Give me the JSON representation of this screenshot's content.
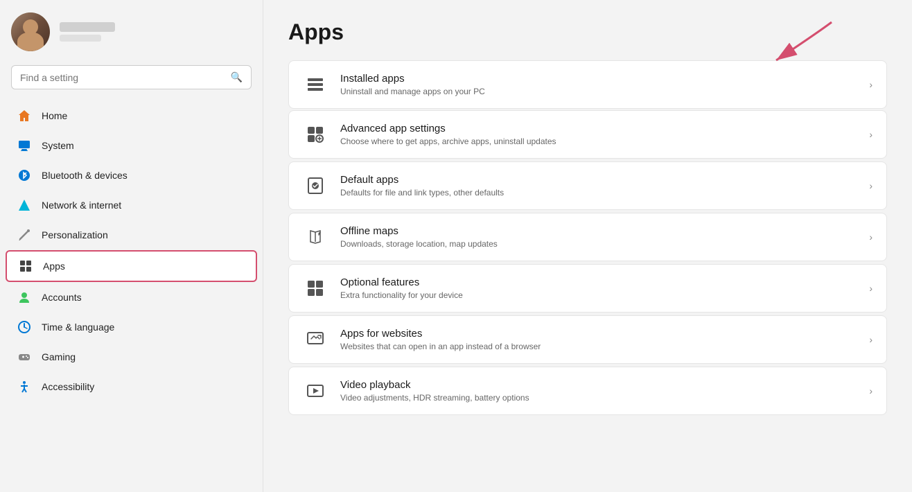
{
  "profile": {
    "name_line1": "",
    "name_line2": ""
  },
  "search": {
    "placeholder": "Find a setting"
  },
  "page_title": "Apps",
  "nav_items": [
    {
      "id": "home",
      "label": "Home",
      "icon": "🏠"
    },
    {
      "id": "system",
      "label": "System",
      "icon": "💻"
    },
    {
      "id": "bluetooth",
      "label": "Bluetooth & devices",
      "icon": "🔵"
    },
    {
      "id": "network",
      "label": "Network & internet",
      "icon": "💠"
    },
    {
      "id": "personalization",
      "label": "Personalization",
      "icon": "✏️"
    },
    {
      "id": "apps",
      "label": "Apps",
      "icon": "⊞",
      "active": true
    },
    {
      "id": "accounts",
      "label": "Accounts",
      "icon": "👤"
    },
    {
      "id": "time",
      "label": "Time & language",
      "icon": "🕐"
    },
    {
      "id": "gaming",
      "label": "Gaming",
      "icon": "🎮"
    },
    {
      "id": "accessibility",
      "label": "Accessibility",
      "icon": "♿"
    }
  ],
  "settings": [
    {
      "id": "installed-apps",
      "title": "Installed apps",
      "subtitle": "Uninstall and manage apps on your PC",
      "has_arrow": true
    },
    {
      "id": "advanced-app-settings",
      "title": "Advanced app settings",
      "subtitle": "Choose where to get apps, archive apps, uninstall updates",
      "has_arrow": false
    },
    {
      "id": "default-apps",
      "title": "Default apps",
      "subtitle": "Defaults for file and link types, other defaults",
      "has_arrow": false
    },
    {
      "id": "offline-maps",
      "title": "Offline maps",
      "subtitle": "Downloads, storage location, map updates",
      "has_arrow": false
    },
    {
      "id": "optional-features",
      "title": "Optional features",
      "subtitle": "Extra functionality for your device",
      "has_arrow": false
    },
    {
      "id": "apps-for-websites",
      "title": "Apps for websites",
      "subtitle": "Websites that can open in an app instead of a browser",
      "has_arrow": false
    },
    {
      "id": "video-playback",
      "title": "Video playback",
      "subtitle": "Video adjustments, HDR streaming, battery options",
      "has_arrow": false
    }
  ],
  "chevron_char": "›",
  "icons": {
    "installed_apps": "≡",
    "advanced_app": "⚙",
    "default_apps": "✓",
    "offline_maps": "📍",
    "optional_features": "⊞",
    "apps_websites": "⊡",
    "video_playback": "▶"
  }
}
